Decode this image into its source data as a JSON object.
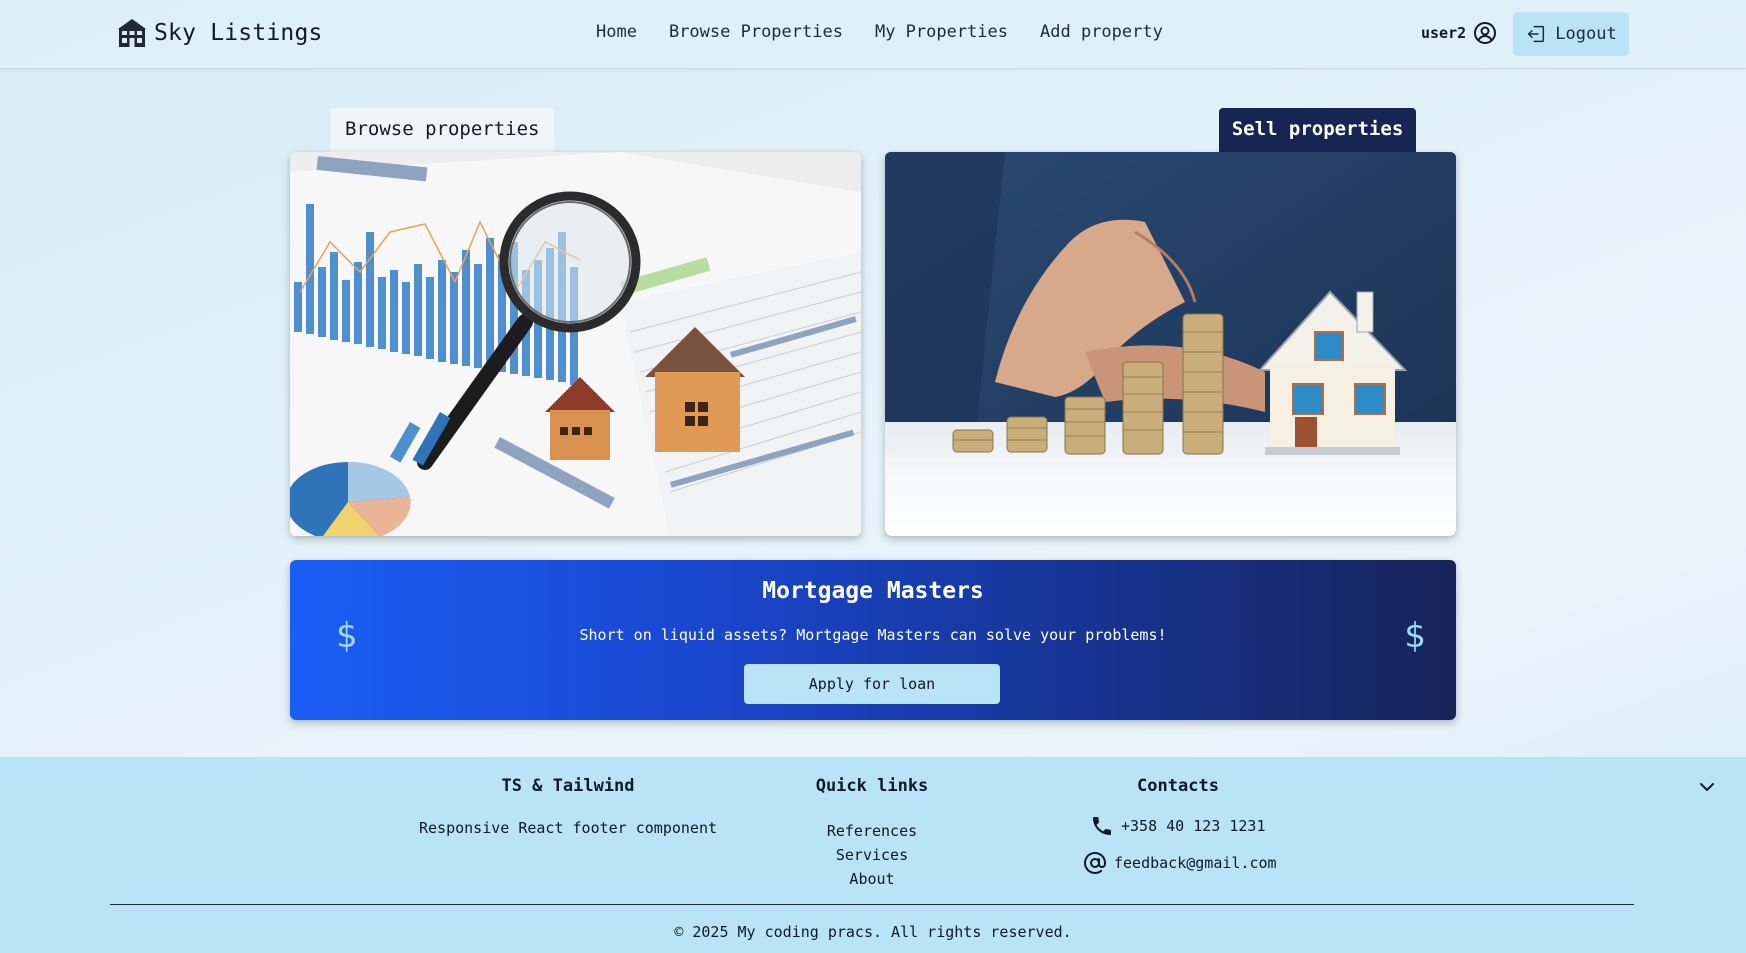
{
  "header": {
    "brand": "Sky Listings",
    "brand_icon": "house-icon",
    "nav": [
      "Home",
      "Browse Properties",
      "My Properties",
      "Add property"
    ],
    "username": "user2",
    "user_icon": "user-circle-icon",
    "logout_label": "Logout",
    "logout_icon": "logout-icon"
  },
  "tabs": {
    "browse": "Browse properties",
    "sell": "Sell properties"
  },
  "mortgage": {
    "title": "Mortgage Masters",
    "text": "Short on liquid assets? Mortgage Masters can solve your problems!",
    "button": "Apply for loan",
    "symbol": "$"
  },
  "footer": {
    "col1_title": "TS & Tailwind",
    "col1_text": "Responsive React footer component",
    "col2_title": "Quick links",
    "links": [
      "References",
      "Services",
      "About"
    ],
    "col3_title": "Contacts",
    "phone": "+358 40 123 1231",
    "email": "feedback@gmail.com",
    "copyright": "© 2025 My coding pracs. All rights reserved."
  },
  "colors": {
    "accent": "#b9e4f8",
    "navy": "#172554",
    "banner_start": "#1a5ef5",
    "banner_end": "#162459"
  }
}
